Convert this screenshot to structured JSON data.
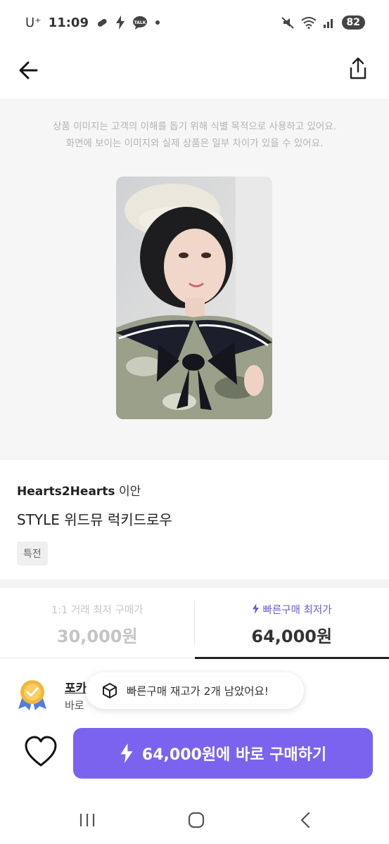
{
  "status_bar": {
    "carrier": "U⁺",
    "time": "11:09",
    "battery": "82",
    "left_icons": [
      "pill-icon",
      "bolt-icon",
      "talk-icon",
      "dot-icon"
    ],
    "right_icons": [
      "mute-icon",
      "wifi-icon",
      "signal-icon"
    ]
  },
  "header": {
    "back_icon": "back-arrow-icon",
    "share_icon": "share-icon"
  },
  "image_notice": {
    "line1": "상품 이미지는 고객의 이해를 돕기 위해 식별 목적으로 사용하고 있어요.",
    "line2": "화면에 보이는 이미지와 실제 상품은 일부 차이가 있을 수 있어요."
  },
  "product": {
    "brand": "Hearts2Hearts",
    "member": "이안",
    "title": "STYLE 위드뮤 럭키드로우",
    "tag": "특전"
  },
  "price_tabs": [
    {
      "label": "1:1 거래 최저 구매가",
      "price": "30,000원",
      "active": false
    },
    {
      "label": "빠른구매 최저가",
      "price": "64,000원",
      "active": true
    }
  ],
  "seller": {
    "name": "포카",
    "desc": "바로"
  },
  "toast": {
    "text": "빠른구매 재고가 2개 남았어요!"
  },
  "buy_button": {
    "label": "64,000원에 바로 구매하기"
  },
  "colors": {
    "accent": "#7b63f0",
    "accent_text": "#6a5bd6",
    "background": "#ffffff",
    "image_bg": "#f6f6f6"
  }
}
